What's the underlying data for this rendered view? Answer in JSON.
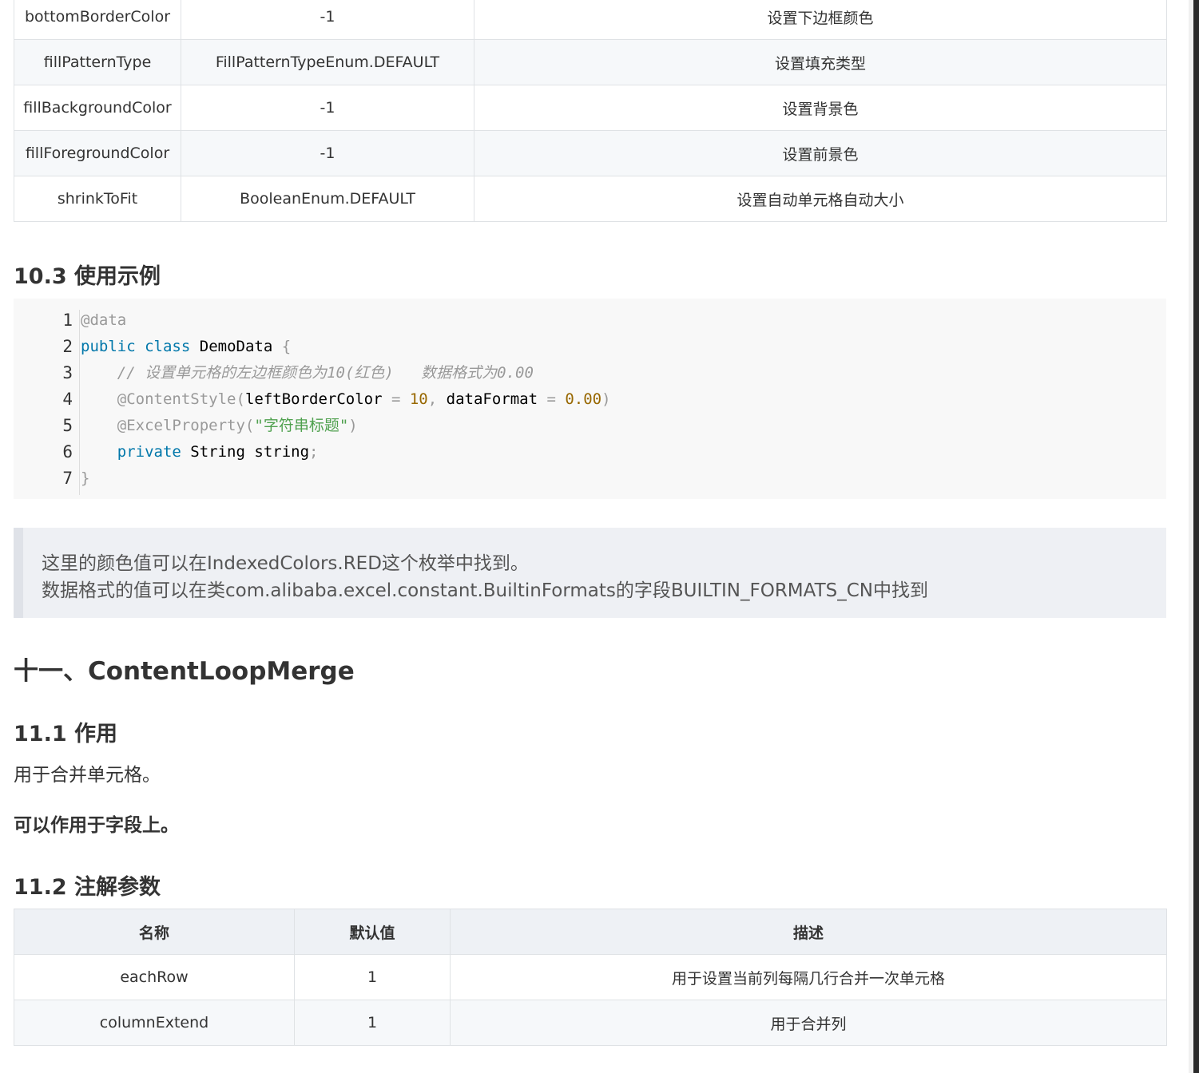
{
  "top_table": {
    "rows": [
      {
        "name": "bottomBorderColor",
        "default": "-1",
        "desc": "设置下边框颜色"
      },
      {
        "name": "fillPatternType",
        "default": "FillPatternTypeEnum.DEFAULT",
        "desc": "设置填充类型"
      },
      {
        "name": "fillBackgroundColor",
        "default": "-1",
        "desc": "设置背景色"
      },
      {
        "name": "fillForegroundColor",
        "default": "-1",
        "desc": "设置前景色"
      },
      {
        "name": "shrinkToFit",
        "default": "BooleanEnum.DEFAULT",
        "desc": "设置自动单元格自动大小"
      }
    ]
  },
  "section_10_3": {
    "title": "10.3 使用示例"
  },
  "code": {
    "line_numbers": [
      "1",
      "2",
      "3",
      "4",
      "5",
      "6",
      "7"
    ],
    "lines": {
      "l1": {
        "anno": "@data"
      },
      "l2": {
        "kw1": "public",
        "kw2": "class",
        "name": "DemoData",
        "brace": "{"
      },
      "l3": {
        "indent": "    ",
        "comment": "// 设置单元格的左边框颜色为10(红色)   数据格式为0.00"
      },
      "l4": {
        "indent": "    ",
        "anno": "@ContentStyle",
        "open": "(",
        "p1": "leftBorderColor",
        "eq1": " = ",
        "v1": "10",
        "comma": ", ",
        "p2": "dataFormat",
        "eq2": " = ",
        "v2": "0.00",
        "close": ")"
      },
      "l5": {
        "indent": "    ",
        "anno": "@ExcelProperty",
        "open": "(",
        "str": "\"字符串标题\"",
        "close": ")"
      },
      "l6": {
        "indent": "    ",
        "kw": "private",
        "type": "String",
        "field": "string",
        "semi": ";"
      },
      "l7": {
        "brace": "}"
      }
    }
  },
  "note": {
    "line1": "这里的颜色值可以在IndexedColors.RED这个枚举中找到。",
    "line2": "数据格式的值可以在类com.alibaba.excel.constant.BuiltinFormats的字段BUILTIN_FORMATS_CN中找到"
  },
  "section_11": {
    "title": "十一、ContentLoopMerge"
  },
  "section_11_1": {
    "title": "11.1 作用",
    "para1": "用于合并单元格。",
    "para2": "可以作用于字段上。"
  },
  "section_11_2": {
    "title": "11.2 注解参数"
  },
  "bottom_table": {
    "headers": [
      "名称",
      "默认值",
      "描述"
    ],
    "rows": [
      {
        "name": "eachRow",
        "default": "1",
        "desc": "用于设置当前列每隔几行合并一次单元格"
      },
      {
        "name": "columnExtend",
        "default": "1",
        "desc": "用于合并列"
      }
    ]
  }
}
